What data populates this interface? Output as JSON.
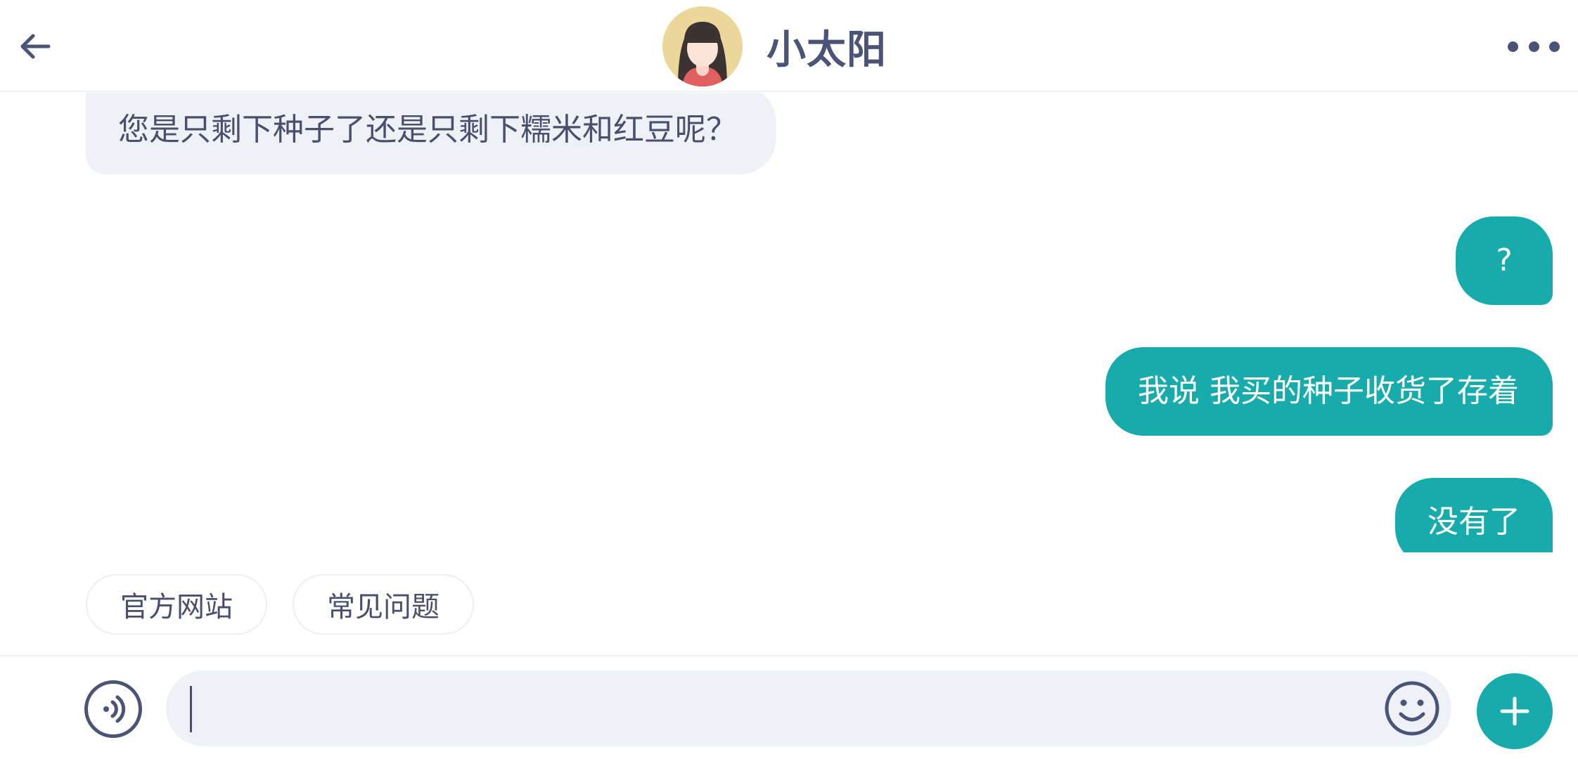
{
  "header": {
    "title": "小太阳",
    "back_icon": "arrow-left-icon",
    "more_icon": "more-dots-icon",
    "avatar": "girl-avatar"
  },
  "messages": [
    {
      "direction": "incoming",
      "text": "您是只剩下种子了还是只剩下糯米和红豆呢？"
    },
    {
      "direction": "outgoing",
      "text": "?"
    },
    {
      "direction": "outgoing",
      "text": "我说 我买的种子收货了存着"
    },
    {
      "direction": "outgoing",
      "text": "没有了"
    }
  ],
  "quick_replies": [
    "官方网站",
    "常见问题"
  ],
  "input_bar": {
    "value": "",
    "voice_icon": "voice-icon",
    "emoji_icon": "emoji-icon",
    "plus_icon": "plus-icon"
  },
  "colors": {
    "accent": "#17abab",
    "incoming_bubble": "#eef2f6",
    "text_dark": "#4b5377"
  }
}
